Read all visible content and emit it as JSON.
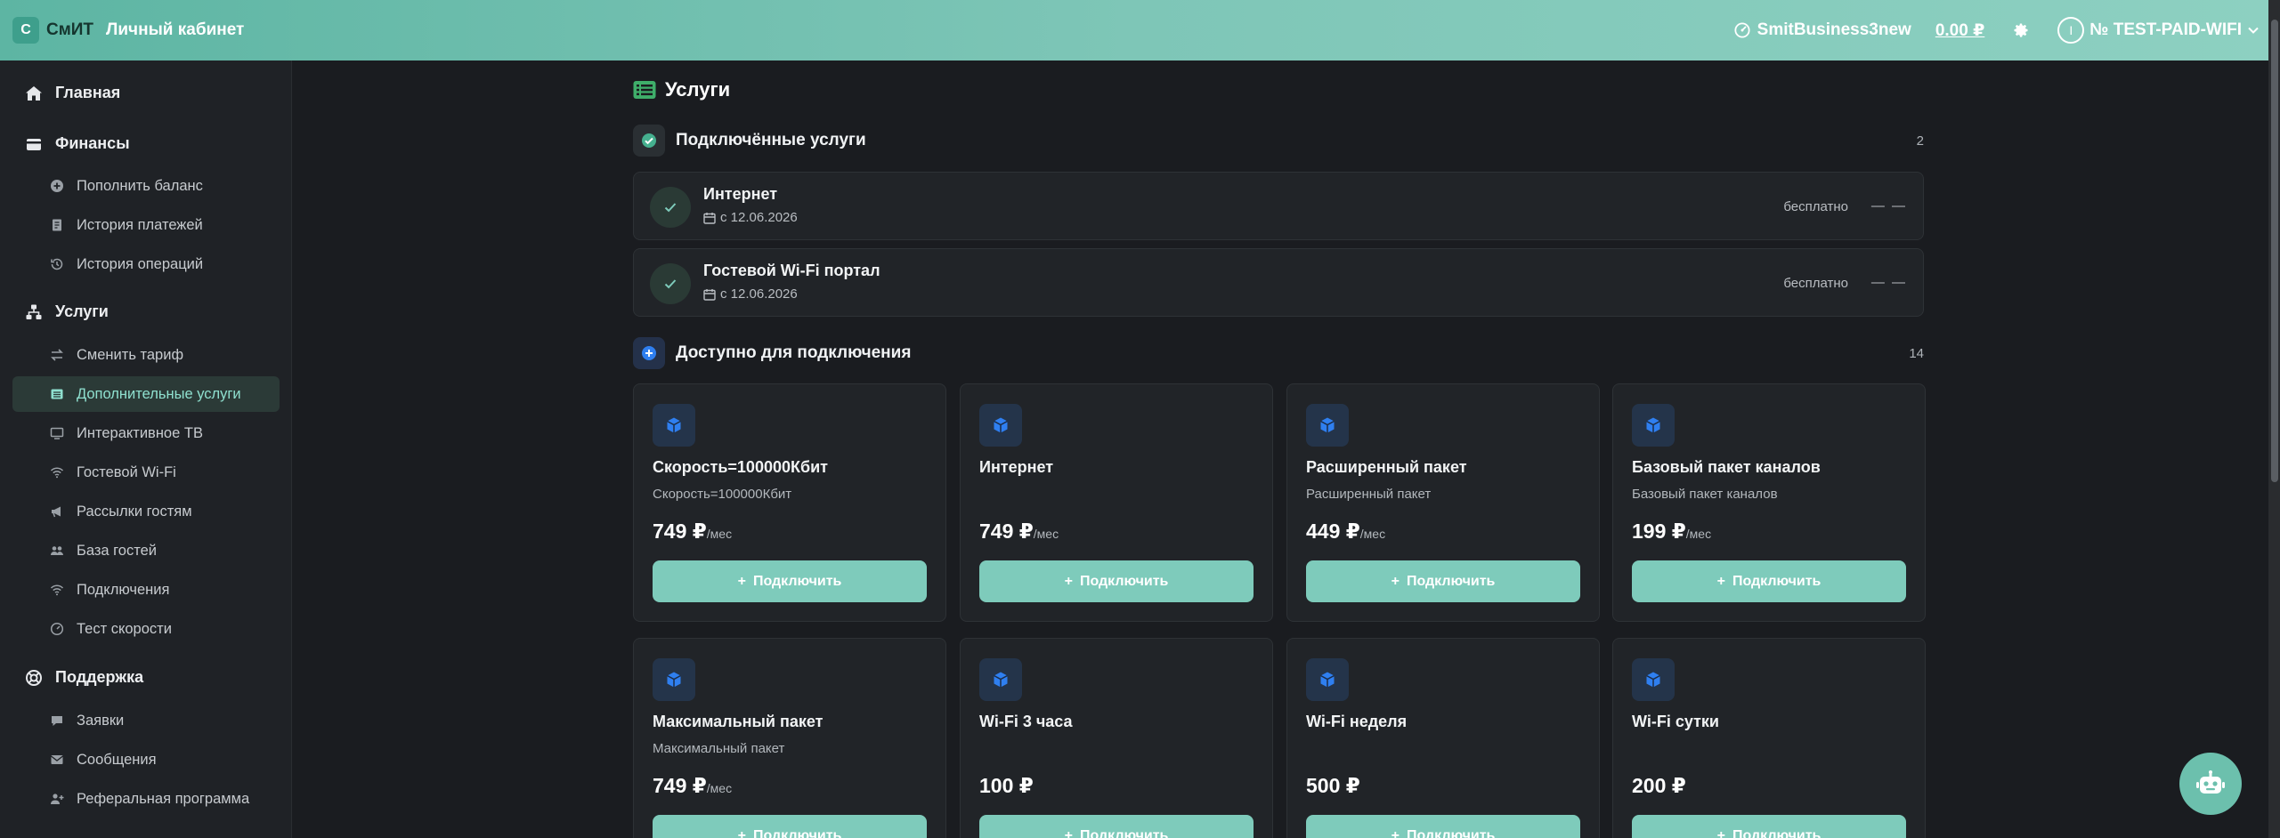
{
  "header": {
    "logo_letter": "С",
    "logo_text": "СмИТ",
    "cabinet_label": "Личный кабинет",
    "account_name": "SmitBusiness3new",
    "balance": "0.00 ₽",
    "user_initial": "I",
    "user_name": "№ TEST-PAID-WIFI"
  },
  "sidebar": {
    "home": "Главная",
    "finance": {
      "label": "Финансы",
      "items": [
        "Пополнить баланс",
        "История платежей",
        "История операций"
      ]
    },
    "services": {
      "label": "Услуги",
      "items": [
        "Сменить тариф",
        "Дополнительные услуги",
        "Интерактивное ТВ",
        "Гостевой Wi-Fi",
        "Рассылки гостям",
        "База гостей",
        "Подключения",
        "Тест скорости"
      ],
      "active": "Дополнительные услуги"
    },
    "support": {
      "label": "Поддержка",
      "items": [
        "Заявки",
        "Сообщения",
        "Реферальная программа"
      ]
    }
  },
  "main": {
    "title": "Услуги",
    "connected": {
      "label": "Подключённые услуги",
      "count": "2",
      "items": [
        {
          "name": "Интернет",
          "date": "с 12.06.2026",
          "price": "бесплатно",
          "extra": "— —"
        },
        {
          "name": "Гостевой Wi-Fi портал",
          "date": "с 12.06.2026",
          "price": "бесплатно",
          "extra": "— —"
        }
      ]
    },
    "available": {
      "label": "Доступно для подключения",
      "count": "14",
      "button_label": "Подключить",
      "cards": [
        {
          "name": "Скорость=100000Кбит",
          "subtitle": "Скорость=100000Кбит",
          "price": "749 ₽",
          "period": "/мес"
        },
        {
          "name": "Интернет",
          "subtitle": "",
          "price": "749 ₽",
          "period": "/мес"
        },
        {
          "name": "Расширенный пакет",
          "subtitle": "Расширенный пакет",
          "price": "449 ₽",
          "period": "/мес"
        },
        {
          "name": "Базовый пакет каналов",
          "subtitle": "Базовый пакет каналов",
          "price": "199 ₽",
          "period": "/мес"
        },
        {
          "name": "Максимальный пакет",
          "subtitle": "Максимальный пакет",
          "price": "749 ₽",
          "period": "/мес"
        },
        {
          "name": "Wi-Fi 3 часа",
          "subtitle": "",
          "price": "100 ₽",
          "period": ""
        },
        {
          "name": "Wi-Fi неделя",
          "subtitle": "",
          "price": "500 ₽",
          "period": ""
        },
        {
          "name": "Wi-Fi сутки",
          "subtitle": "",
          "price": "200 ₽",
          "period": ""
        }
      ]
    }
  },
  "colors": {
    "accent": "#7ecbbb",
    "header_start": "#5db5a3",
    "header_end": "#8dd0c1",
    "background": "#1a1c20",
    "card_icon": "#2f7ff0"
  },
  "icons": {
    "account": "speedometer-icon",
    "settings": "gear-icon",
    "user_menu": "chevron-down-icon",
    "card": "cube-icon",
    "bot": "robot-icon"
  }
}
